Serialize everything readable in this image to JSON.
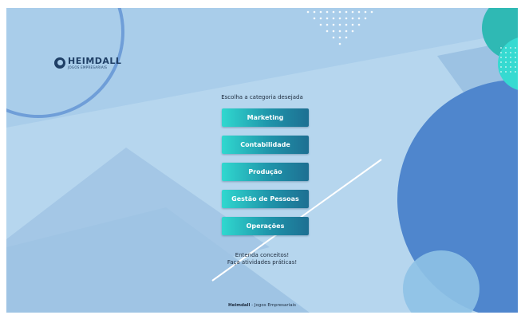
{
  "brand": {
    "name": "HEIMDALL",
    "subtitle": "JOGOS EMPRESARIAIS"
  },
  "prompt": "Escolha a categoria desejada",
  "categories": [
    {
      "label": "Marketing"
    },
    {
      "label": "Contabilidade"
    },
    {
      "label": "Produção"
    },
    {
      "label": "Gestão de Pessoas"
    },
    {
      "label": "Operações"
    }
  ],
  "tagline": {
    "line1": "Entenda conceitos!",
    "line2": "Faça atividades práticas!"
  },
  "footer": {
    "brand": "Heimdall",
    "separator": " - ",
    "text": "Jogos Empresariais"
  },
  "colors": {
    "background": "#a9cdea",
    "button_start": "#30d8cf",
    "button_end": "#1d6f92",
    "big_circle": "#4f86cd",
    "accent_teal": "#30d8cf"
  }
}
